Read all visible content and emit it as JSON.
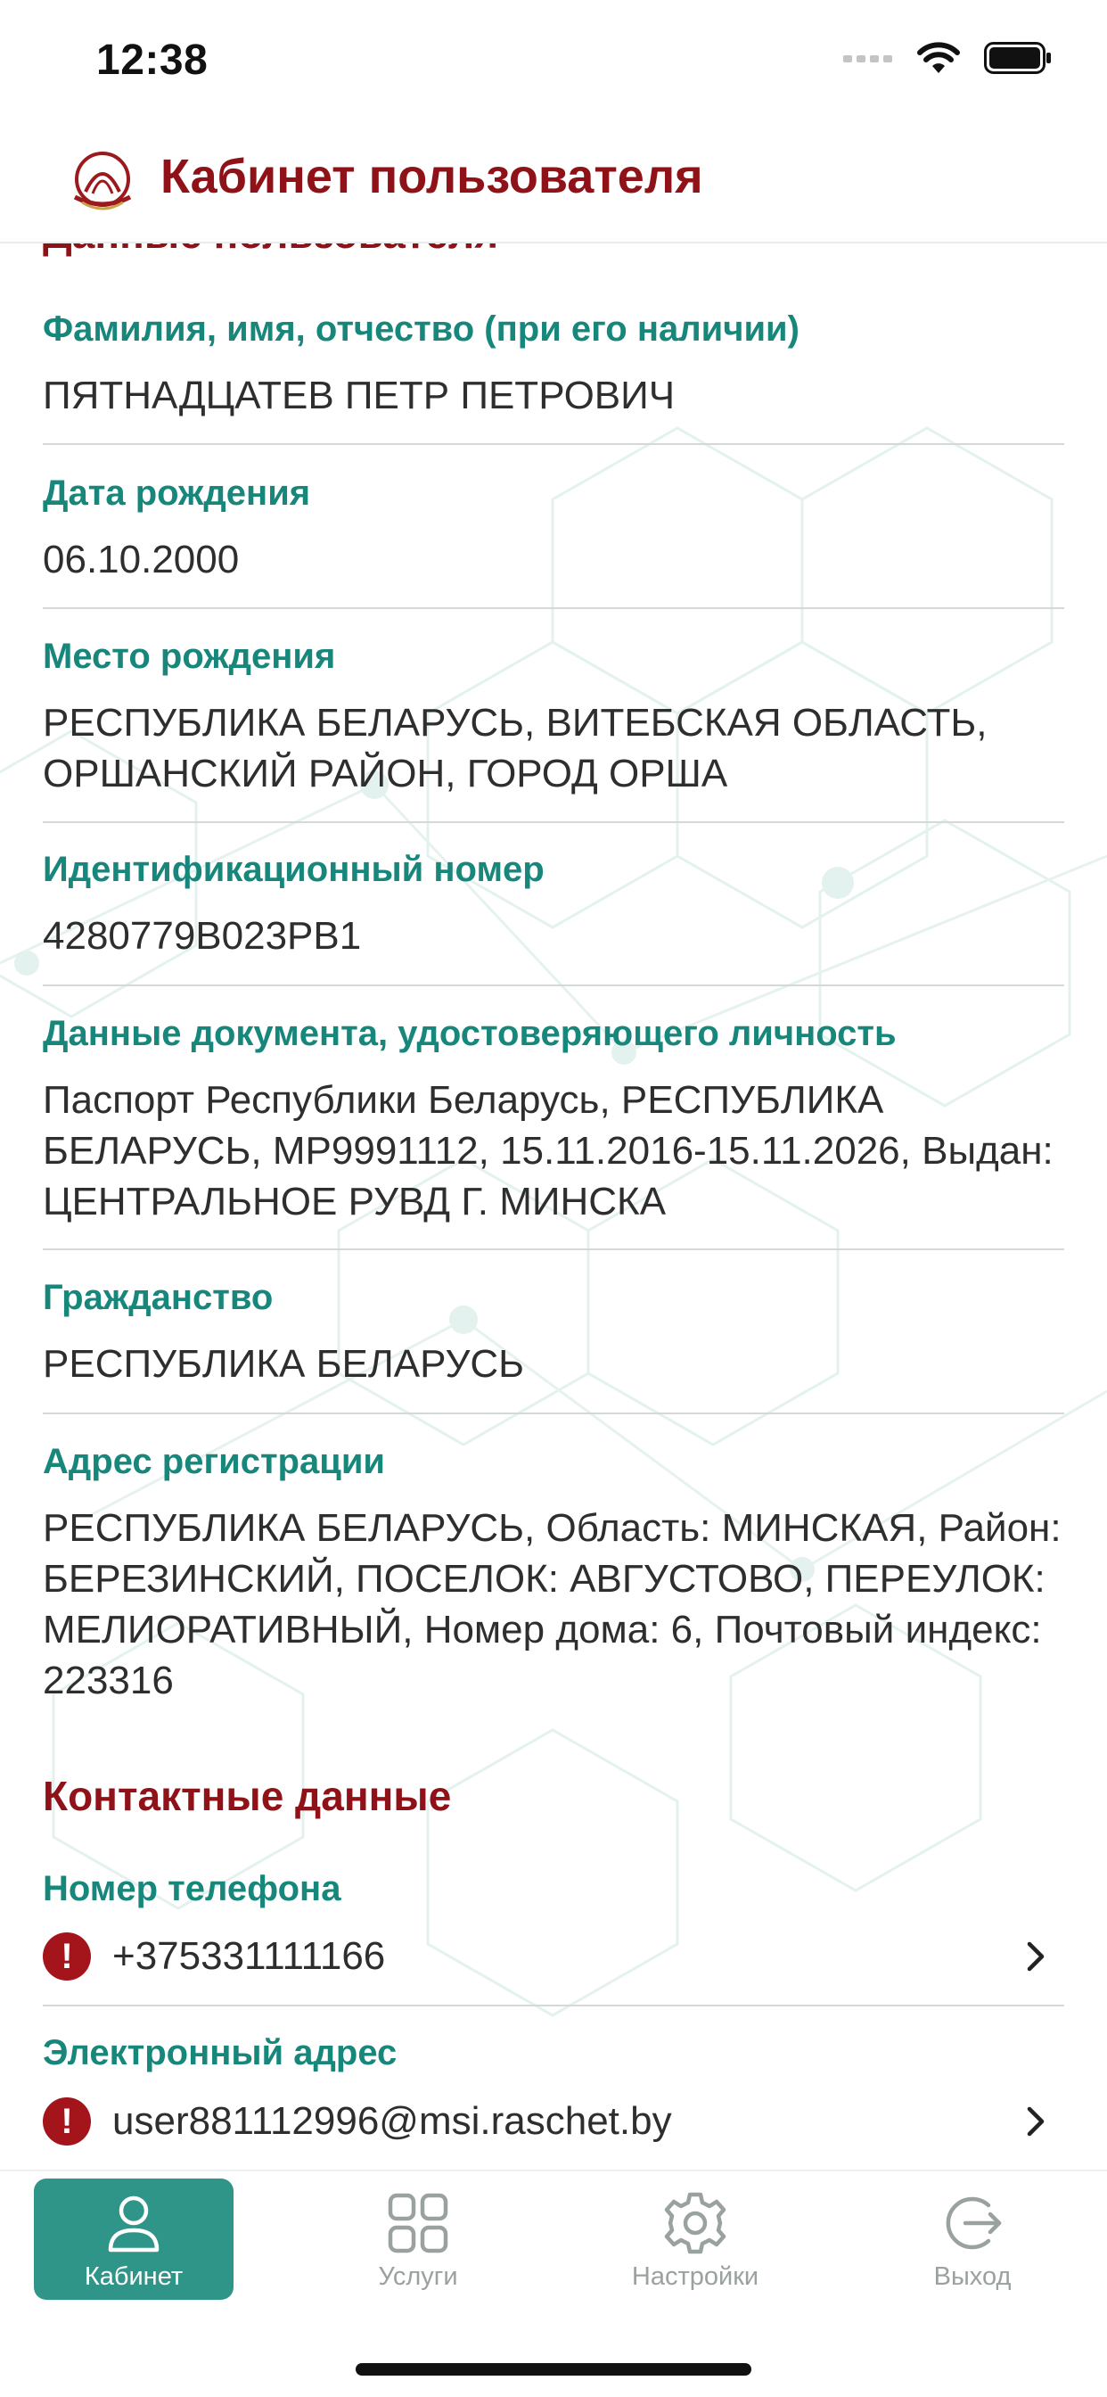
{
  "status_bar": {
    "time": "12:38"
  },
  "header": {
    "title": "Кабинет пользователя"
  },
  "sections": {
    "personal_title_partial": "Данные пользователя",
    "contacts_title": "Контактные данные"
  },
  "fields": [
    {
      "label": "Фамилия, имя, отчество (при его наличии)",
      "value": "ПЯТНАДЦАТЕВ ПЕТР ПЕТРОВИЧ"
    },
    {
      "label": "Дата рождения",
      "value": "06.10.2000"
    },
    {
      "label": "Место рождения",
      "value": "РЕСПУБЛИКА БЕЛАРУСЬ, ВИТЕБСКАЯ ОБЛАСТЬ, ОРШАНСКИЙ РАЙОН, ГОРОД ОРША"
    },
    {
      "label": "Идентификационный номер",
      "value": "4280779B023PB1"
    },
    {
      "label": "Данные документа, удостоверяющего личность",
      "value": "Паспорт Республики Беларусь, РЕСПУБЛИКА БЕЛАРУСЬ, MP9991112, 15.11.2016-15.11.2026, Выдан: ЦЕНТРАЛЬНОЕ РУВД Г. МИНСКА"
    },
    {
      "label": "Гражданство",
      "value": "РЕСПУБЛИКА БЕЛАРУСЬ"
    },
    {
      "label": "Адрес регистрации",
      "value": "РЕСПУБЛИКА БЕЛАРУСЬ, Область: МИНСКАЯ, Район: БЕРЕЗИНСКИЙ, ПОСЕЛОК: АВГУСТОВО, ПЕРЕУЛОК: МЕЛИОРАТИВНЫЙ, Номер дома: 6, Почтовый индекс: 223316"
    }
  ],
  "contacts": [
    {
      "label": "Номер телефона",
      "value": "+375331111166",
      "alert_icon": "exclamation-circle-icon"
    },
    {
      "label": "Электронный адрес",
      "value": "user881112996@msi.raschet.by",
      "alert_icon": "exclamation-circle-icon"
    }
  ],
  "tabs": [
    {
      "label": "Кабинет",
      "icon": "user-icon",
      "active": true
    },
    {
      "label": "Услуги",
      "icon": "grid-icon",
      "active": false
    },
    {
      "label": "Настройки",
      "icon": "gear-icon",
      "active": false
    },
    {
      "label": "Выход",
      "icon": "logout-icon",
      "active": false
    }
  ],
  "colors": {
    "brand_red": "#8f1218",
    "label_teal": "#17867b",
    "active_tab": "#2f9589",
    "alert_red": "#a3141b"
  }
}
